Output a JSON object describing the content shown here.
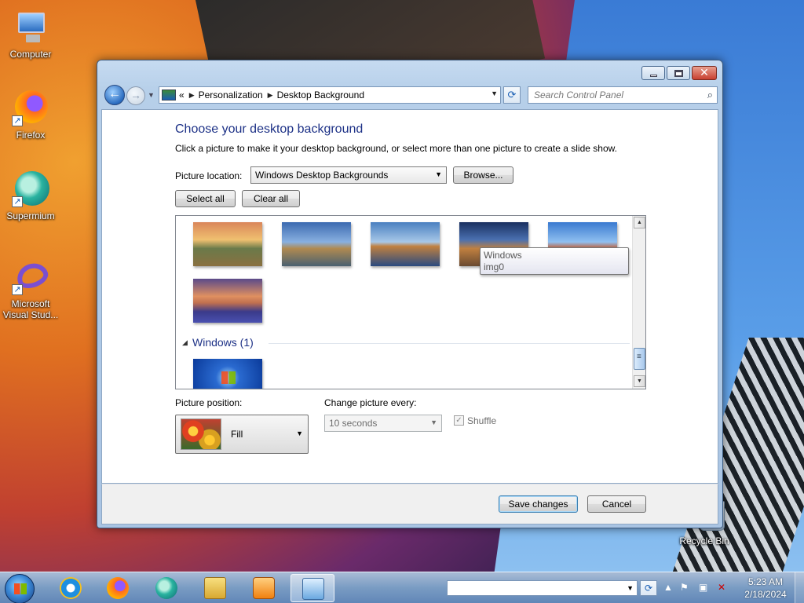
{
  "desktop": {
    "icons": [
      {
        "label": "Computer"
      },
      {
        "label": "Firefox"
      },
      {
        "label": "Supermium"
      },
      {
        "label": "Microsoft Visual Stud..."
      },
      {
        "label": "Recycle Bin"
      }
    ]
  },
  "window": {
    "address": {
      "overflow": "«",
      "crumb1": "Personalization",
      "crumb2": "Desktop Background"
    },
    "search_placeholder": "Search Control Panel",
    "heading": "Choose your desktop background",
    "description": "Click a picture to make it your desktop background, or select more than one picture to create a slide show.",
    "picture_location_label": "Picture location:",
    "picture_location_value": "Windows Desktop Backgrounds",
    "browse_label": "Browse...",
    "select_all_label": "Select all",
    "clear_all_label": "Clear all",
    "group_name": "Windows (1)",
    "tooltip": {
      "line1": "Windows",
      "line2": "img0"
    },
    "picture_position_label": "Picture position:",
    "picture_position_value": "Fill",
    "change_every_label": "Change picture every:",
    "change_every_value": "10 seconds",
    "shuffle_label": "Shuffle",
    "save_label": "Save changes",
    "cancel_label": "Cancel"
  },
  "taskbar": {
    "time": "5:23 AM",
    "date": "2/18/2024"
  }
}
